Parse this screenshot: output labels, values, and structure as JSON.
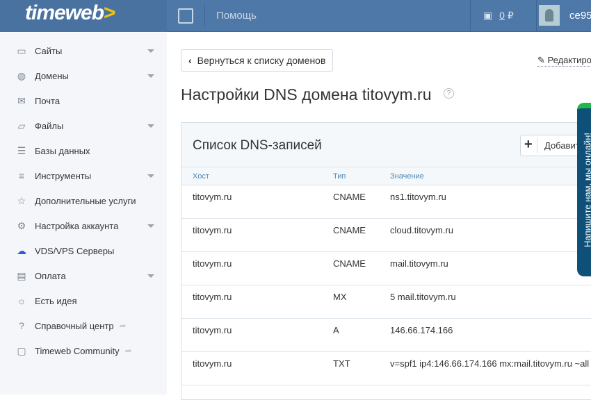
{
  "header": {
    "logo": "timeweb",
    "logo_arrow": ">",
    "help": "Помощь",
    "balance": "0",
    "currency": "₽",
    "user": "ce95"
  },
  "sidebar": {
    "items": [
      {
        "label": "Сайты",
        "icon": "monitor-icon",
        "caret": true
      },
      {
        "label": "Домены",
        "icon": "globe-icon",
        "caret": true
      },
      {
        "label": "Почта",
        "icon": "mail-icon",
        "caret": false
      },
      {
        "label": "Файлы",
        "icon": "folder-icon",
        "caret": true
      },
      {
        "label": "Базы данных",
        "icon": "database-icon",
        "caret": false
      },
      {
        "label": "Инструменты",
        "icon": "sliders-icon",
        "caret": true
      },
      {
        "label": "Дополнительные услуги",
        "icon": "star-icon",
        "caret": false
      },
      {
        "label": "Настройка аккаунта",
        "icon": "gear-icon",
        "caret": true
      },
      {
        "label": "VDS/VPS Серверы",
        "icon": "cloud-icon",
        "caret": false
      },
      {
        "label": "Оплата",
        "icon": "wallet-icon",
        "caret": true
      },
      {
        "label": "Есть идея",
        "icon": "bulb-icon",
        "caret": false
      },
      {
        "label": "Справочный центр",
        "icon": "help-icon",
        "caret": false,
        "ext": true
      },
      {
        "label": "Timeweb Community",
        "icon": "chat-icon",
        "caret": false,
        "ext": true
      }
    ]
  },
  "main": {
    "back": "Вернуться к списку доменов",
    "edit": "Редактиро",
    "title": "Настройки DNS домена titovym.ru",
    "help": "?",
    "card_title": "Список DNS-записей",
    "add": "Добавить",
    "columns": [
      "Хост",
      "Тип",
      "Значение"
    ],
    "rows": [
      [
        "titovym.ru",
        "CNAME",
        "ns1.titovym.ru"
      ],
      [
        "titovym.ru",
        "CNAME",
        "cloud.titovym.ru"
      ],
      [
        "titovym.ru",
        "CNAME",
        "mail.titovym.ru"
      ],
      [
        "titovym.ru",
        "MX",
        "5 mail.titovym.ru"
      ],
      [
        "titovym.ru",
        "A",
        "146.66.174.166"
      ],
      [
        "titovym.ru",
        "TXT",
        "v=spf1 ip4:146.66.174.166 mx:mail.titovym.ru ~all"
      ]
    ]
  },
  "chat": "Напишите нам, мы онлайн!"
}
